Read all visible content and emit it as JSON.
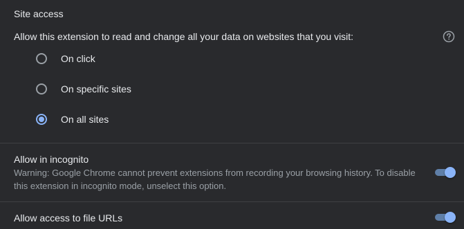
{
  "site_access": {
    "title": "Site access",
    "description": "Allow this extension to read and change all your data on websites that you visit:",
    "help_icon": "help-circle-icon",
    "options": [
      {
        "label": "On click",
        "checked": false
      },
      {
        "label": "On specific sites",
        "checked": false
      },
      {
        "label": "On all sites",
        "checked": true
      }
    ]
  },
  "incognito": {
    "title": "Allow in incognito",
    "warning": "Warning: Google Chrome cannot prevent extensions from recording your browsing history. To disable this extension in incognito mode, unselect this option.",
    "enabled": true
  },
  "file_urls": {
    "title": "Allow access to file URLs",
    "enabled": true
  },
  "colors": {
    "background": "#292a2d",
    "accent": "#8ab4f8",
    "text": "#e8eaed",
    "secondary_text": "#9aa0a6"
  }
}
